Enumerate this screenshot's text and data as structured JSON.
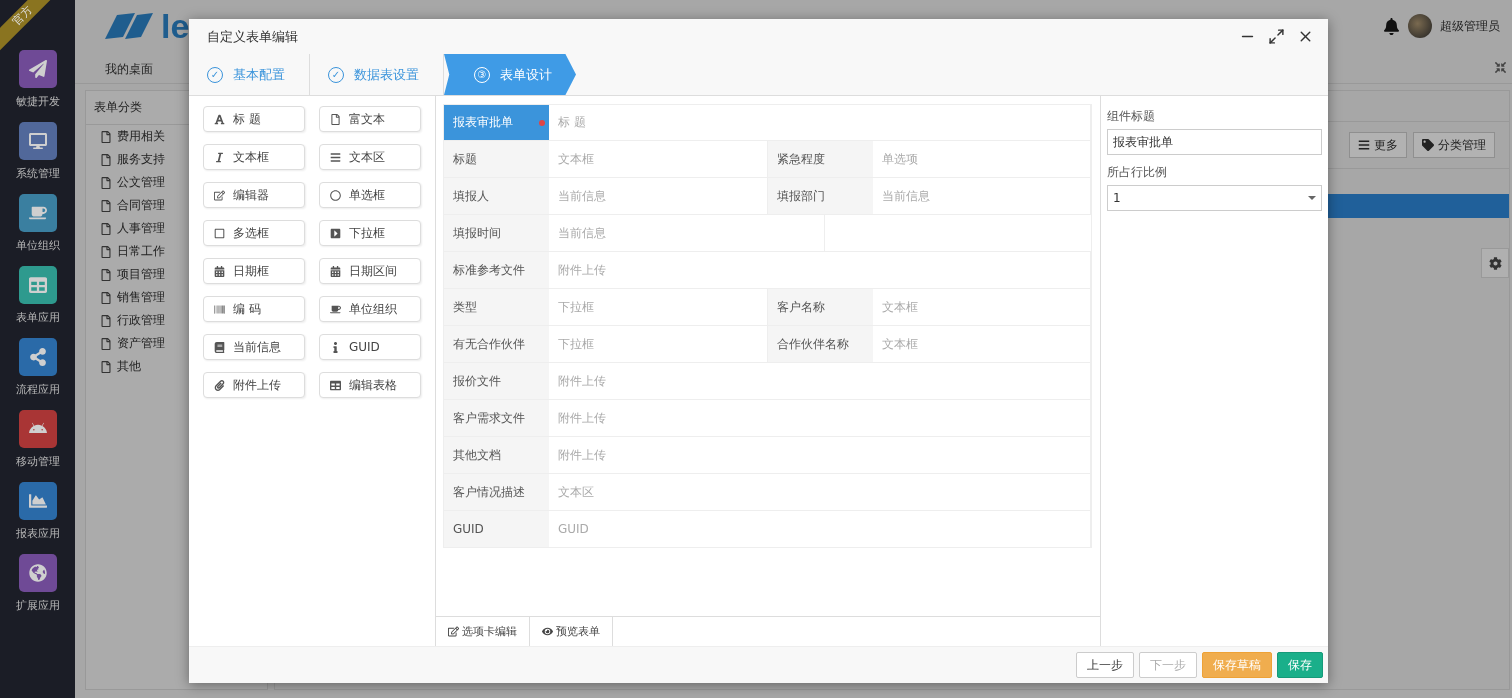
{
  "ribbon": "官方",
  "app_sidebar": [
    {
      "label": "敏捷开发",
      "color": "#6f4a96"
    },
    {
      "label": "系统管理",
      "color": "#51689a"
    },
    {
      "label": "单位组织",
      "color": "#3a7fa0"
    },
    {
      "label": "表单应用",
      "color": "#2e9a8e"
    },
    {
      "label": "流程应用",
      "color": "#2a6aa8"
    },
    {
      "label": "移动管理",
      "color": "#a93535"
    },
    {
      "label": "报表应用",
      "color": "#2a6aa8"
    },
    {
      "label": "扩展应用",
      "color": "#6f4a96"
    }
  ],
  "header": {
    "logo": "le",
    "user": "超级管理员"
  },
  "nav_tabs": [
    {
      "label": "我的桌面",
      "selected": true
    }
  ],
  "category_panel": {
    "title": "表单分类",
    "items": [
      "费用相关",
      "服务支持",
      "公文管理",
      "合同管理",
      "人事管理",
      "日常工作",
      "项目管理",
      "销售管理",
      "行政管理",
      "资产管理",
      "其他"
    ]
  },
  "toolbar": [
    "更多",
    "分类管理"
  ],
  "dialog": {
    "title": "自定义表单编辑",
    "steps": [
      {
        "number": "✓",
        "label": "基本配置",
        "selected": false
      },
      {
        "number": "✓",
        "label": "数据表设置",
        "selected": false
      },
      {
        "number": "③",
        "label": "表单设计",
        "selected": true
      }
    ],
    "components": [
      "标 题",
      "富文本",
      "文本框",
      "文本区",
      "编辑器",
      "单选框",
      "多选框",
      "下拉框",
      "日期框",
      "日期区间",
      "编 码",
      "单位组织",
      "当前信息",
      "GUID",
      "附件上传",
      "编辑表格"
    ],
    "form_rows": [
      {
        "kind": "full",
        "selected": true,
        "cells": [
          {
            "label": "报表审批单",
            "value": "标 题"
          }
        ]
      },
      {
        "kind": "pair",
        "selected": false,
        "cells": [
          {
            "label": "标题",
            "value": "文本框"
          },
          {
            "label": "紧急程度",
            "value": "单选项"
          }
        ]
      },
      {
        "kind": "pair",
        "selected": false,
        "cells": [
          {
            "label": "填报人",
            "value": "当前信息"
          },
          {
            "label": "填报部门",
            "value": "当前信息"
          }
        ]
      },
      {
        "kind": "half",
        "selected": false,
        "cells": [
          {
            "label": "填报时间",
            "value": "当前信息"
          }
        ]
      },
      {
        "kind": "full",
        "selected": false,
        "cells": [
          {
            "label": "标准参考文件",
            "value": "附件上传"
          }
        ]
      },
      {
        "kind": "pair",
        "selected": false,
        "cells": [
          {
            "label": "类型",
            "value": "下拉框"
          },
          {
            "label": "客户名称",
            "value": "文本框"
          }
        ]
      },
      {
        "kind": "pair",
        "selected": false,
        "cells": [
          {
            "label": "有无合作伙伴",
            "value": "下拉框"
          },
          {
            "label": "合作伙伴名称",
            "value": "文本框"
          }
        ]
      },
      {
        "kind": "full",
        "selected": false,
        "cells": [
          {
            "label": "报价文件",
            "value": "附件上传"
          }
        ]
      },
      {
        "kind": "full",
        "selected": false,
        "cells": [
          {
            "label": "客户需求文件",
            "value": "附件上传"
          }
        ]
      },
      {
        "kind": "full",
        "selected": false,
        "cells": [
          {
            "label": "其他文档",
            "value": "附件上传"
          }
        ]
      },
      {
        "kind": "full",
        "selected": false,
        "cells": [
          {
            "label": "客户情况描述",
            "value": "文本区"
          }
        ]
      },
      {
        "kind": "full",
        "selected": false,
        "cells": [
          {
            "label": "GUID",
            "value": "GUID"
          }
        ]
      }
    ],
    "bottom_tabs": [
      "选项卡编辑",
      "预览表单"
    ],
    "properties": {
      "title_label": "组件标题",
      "title_value": "报表审批单",
      "ratio_label": "所占行比例",
      "ratio_value": "1"
    },
    "buttons": [
      {
        "label": "上一步",
        "kind": "default",
        "disabled": false
      },
      {
        "label": "下一步",
        "kind": "default",
        "disabled": true
      },
      {
        "label": "保存草稿",
        "kind": "warning",
        "disabled": false
      },
      {
        "label": "保存",
        "kind": "success",
        "disabled": false
      }
    ]
  }
}
